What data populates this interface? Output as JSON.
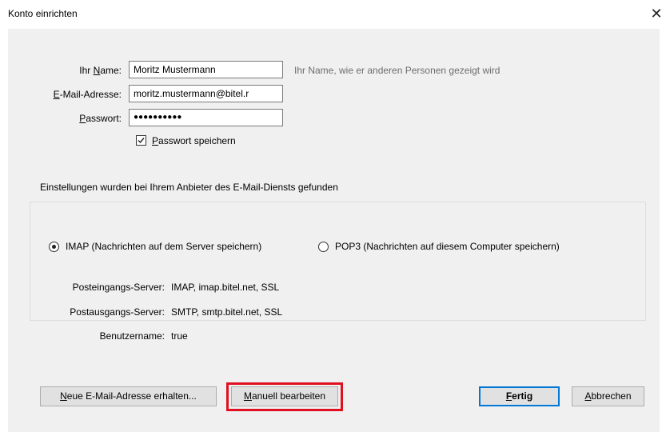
{
  "window": {
    "title": "Konto einrichten",
    "close_glyph": "✕"
  },
  "form": {
    "name": {
      "label_pre": "Ihr ",
      "label_access": "N",
      "label_post": "ame:",
      "value": "Moritz Mustermann",
      "hint": "Ihr Name, wie er anderen Personen gezeigt wird"
    },
    "email": {
      "label_access": "E",
      "label_post": "-Mail-Adresse:",
      "value": "moritz.mustermann@bitel.r"
    },
    "password": {
      "label_access": "P",
      "label_post": "asswort:",
      "value": "●●●●●●●●●●"
    },
    "save_password": {
      "label_access": "P",
      "label_post": "asswort speichern",
      "checked": true
    }
  },
  "found_text": "Einstellungen wurden bei Ihrem Anbieter des E-Mail-Diensts gefunden",
  "protocol": {
    "imap_label": "IMAP (Nachrichten auf dem Server speichern)",
    "pop3_label": "POP3 (Nachrichten auf diesem Computer speichern)",
    "selected": "IMAP"
  },
  "server_info": [
    {
      "key": "Posteingangs-Server:",
      "value": "IMAP, imap.bitel.net, SSL"
    },
    {
      "key": "Postausgangs-Server:",
      "value": "SMTP, smtp.bitel.net, SSL"
    },
    {
      "key": "Benutzername:",
      "value": "true"
    }
  ],
  "buttons": {
    "new_address": {
      "access": "N",
      "rest": "eue E-Mail-Adresse erhalten..."
    },
    "manual": {
      "access": "M",
      "rest": "anuell bearbeiten"
    },
    "done": {
      "access": "F",
      "rest": "ertig"
    },
    "cancel": {
      "access": "A",
      "rest": "bbrechen"
    }
  },
  "colors": {
    "highlight": "#e01020",
    "panel_bg": "#f0f0f0",
    "default_button_border": "#0078d7"
  }
}
